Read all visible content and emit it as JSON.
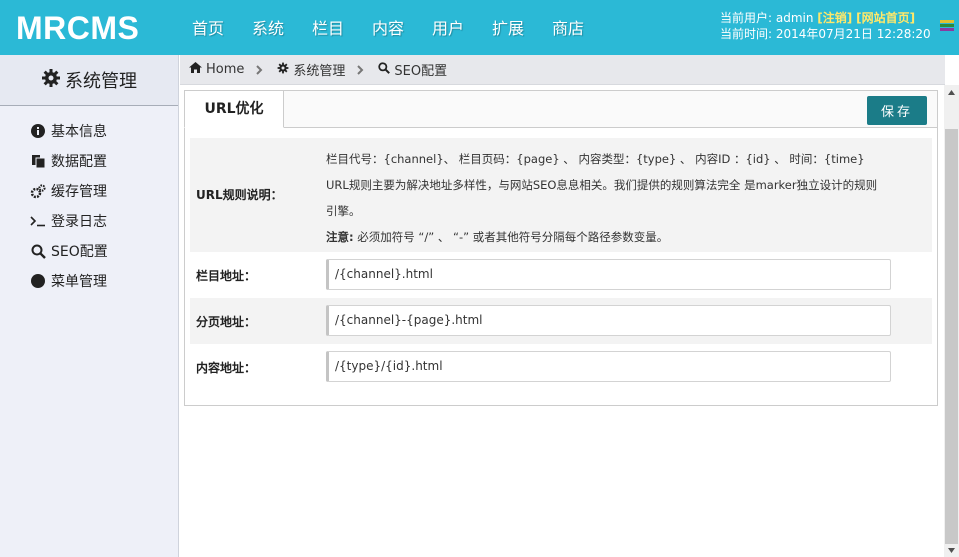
{
  "brand": {
    "logo": "MRCMS"
  },
  "topnav": {
    "items": [
      "首页",
      "系统",
      "栏目",
      "内容",
      "用户",
      "扩展",
      "商店"
    ]
  },
  "userinfo": {
    "user_prefix": "当前用户: admin",
    "logout": "[注销]",
    "site_home": "[网站首页]",
    "time_line": "当前时间: 2014年07月21日 12:28:20"
  },
  "colors": {
    "header_bg": "#2bb9d6",
    "accent_btn": "#1b7c88",
    "link_yellow": "#ffe86a"
  },
  "sidebar": {
    "title": "系统管理",
    "items": [
      {
        "label": "基本信息",
        "icon": "info-icon"
      },
      {
        "label": "数据配置",
        "icon": "copy-icon"
      },
      {
        "label": "缓存管理",
        "icon": "cogs-icon"
      },
      {
        "label": "登录日志",
        "icon": "terminal-icon"
      },
      {
        "label": "SEO配置",
        "icon": "search-icon"
      },
      {
        "label": "菜单管理",
        "icon": "circle-icon"
      }
    ]
  },
  "breadcrumb": {
    "home": "Home",
    "system": "系统管理",
    "seo": "SEO配置"
  },
  "panel": {
    "tab": "URL优化",
    "save": "保存",
    "rule_label": "URL规则说明：",
    "rule_line1": "栏目代号：{channel}、 栏目页码：{page} 、 内容类型：{type} 、 内容ID ：{id} 、 时间：{time}",
    "rule_line2": "URL规则主要为解决地址多样性，与网站SEO息息相关。我们提供的规则算法完全 是marker独立设计的规则引擎。",
    "note_label": "注意:",
    "note_text": "必须加符号 “/” 、 “-” 或者其他符号分隔每个路径参数变量。",
    "channel_label": "栏目地址：",
    "channel_value": "/{channel}.html",
    "page_label": "分页地址：",
    "page_value": "/{channel}-{page}.html",
    "content_label": "内容地址：",
    "content_value": "/{type}/{id}.html"
  }
}
